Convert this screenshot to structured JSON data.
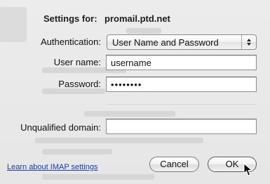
{
  "header": {
    "title_label": "Settings for:",
    "account": "promail.ptd.net"
  },
  "form": {
    "authentication_label": "Authentication:",
    "authentication_value": "User Name and Password",
    "username_label": "User name:",
    "username_value": "username",
    "password_label": "Password:",
    "password_value": "••••••••",
    "domain_label": "Unqualified domain:",
    "domain_value": ""
  },
  "footer": {
    "help_link": "Learn about IMAP settings",
    "cancel_label": "Cancel",
    "ok_label": "OK"
  }
}
